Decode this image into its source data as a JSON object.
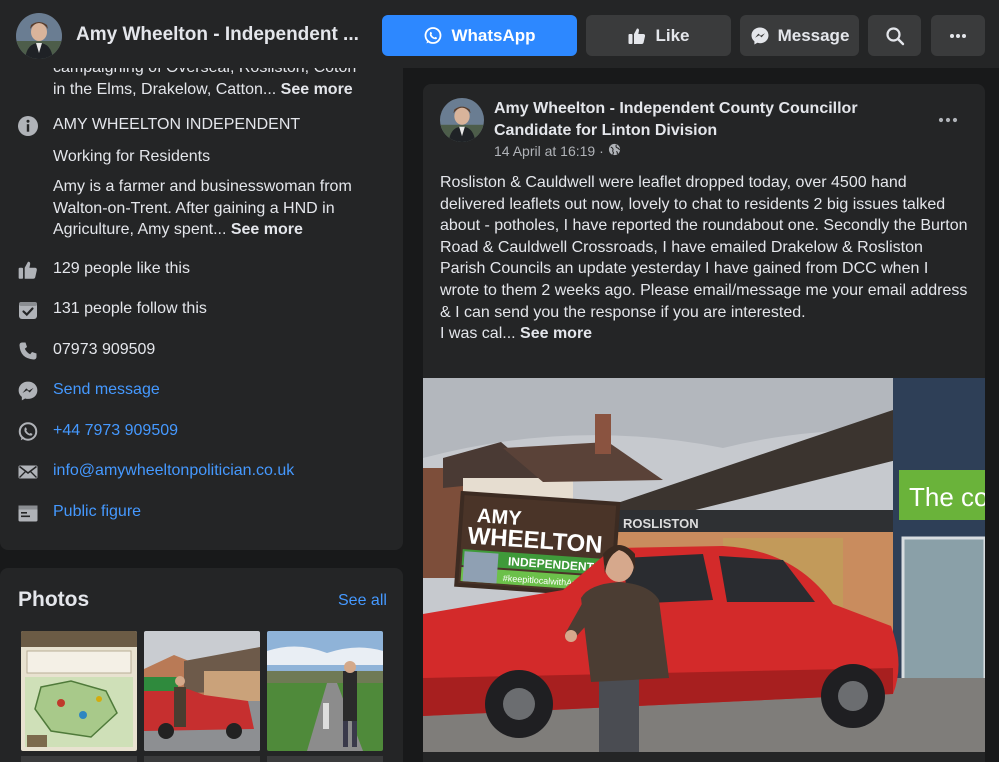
{
  "header": {
    "page_name": "Amy Wheelton - Independent ...",
    "buttons": {
      "whatsapp": "WhatsApp",
      "like": "Like",
      "message": "Message"
    }
  },
  "intro": {
    "truncated_line_1": "campaigning of Overseal, Rosliston, Coton",
    "truncated_line_2": "in the Elms, Drakelow, Catton...",
    "truncated_see_more": "See more",
    "about_title": "AMY WHEELTON INDEPENDENT",
    "about_subtitle": "Working for Residents",
    "about_bio": "Amy is a farmer and businesswoman from Walton-on-Trent. After gaining a HND in Agriculture, Amy spent...",
    "about_see_more": "See more",
    "likes": "129 people like this",
    "follows": "131 people follow this",
    "phone": "07973 909509",
    "send_message": "Send message",
    "whatsapp_number": "+44 7973 909509",
    "email": "info@amywheeltonpolitician.co.uk",
    "category": "Public figure"
  },
  "photos": {
    "title": "Photos",
    "see_all": "See all"
  },
  "post": {
    "author": "Amy Wheelton - Independent County Councillor Candidate for Linton Division",
    "time": "14 April at 16:19 ·",
    "body": "Rosliston & Cauldwell were leaflet dropped today, over 4500 hand delivered leaflets out now, lovely to chat to residents 2 big issues talked about -  potholes, I have reported the roundabout one. Secondly the Burton Road & Cauldwell Crossroads, I have emailed Drakelow & Rosliston Parish Councils an update yesterday I have gained from DCC when I wrote to them 2 weeks ago. Please email/message me your email address & I can send you the response if you are interested.",
    "body_last": "I was cal...",
    "see_more": "See more",
    "photo": {
      "sign_line1": "AMY",
      "sign_line2": "WHEELTON",
      "sign_line3": "INDEPENDENT",
      "sign_hashtag": "#keepitlocalwithAmy",
      "shop_sign": "ROSLISTON",
      "store_sign": "The co"
    }
  },
  "colors": {
    "background": "#18191a",
    "card": "#242526",
    "button": "#3a3b3c",
    "accent": "#2d88ff",
    "link": "#4599ff",
    "secondary_text": "#b0b3b8"
  },
  "icons": [
    "whatsapp-icon",
    "thumbs-up-icon",
    "messenger-icon",
    "search-icon",
    "more-icon",
    "info-icon",
    "follow-icon",
    "phone-icon",
    "email-icon",
    "category-icon",
    "globe-icon"
  ]
}
